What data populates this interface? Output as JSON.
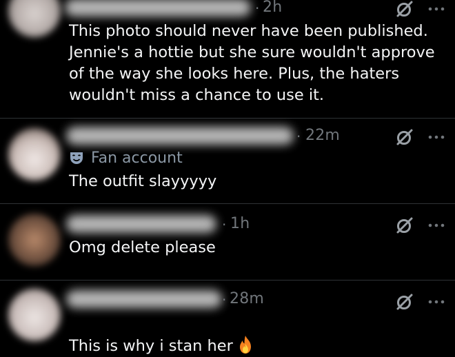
{
  "posts": [
    {
      "time": "2h",
      "text": "This photo should never have been published.\nJennie's a hottie but she sure wouldn't approve\nof the way she looks here. Plus, the haters\nwouldn't miss a chance to use it.",
      "icons": [
        "grok-icon",
        "more-icon"
      ]
    },
    {
      "time": "22m",
      "badge": "Fan account",
      "text": "The outfit slayyyyy",
      "icons": [
        "masks-icon",
        "grok-icon",
        "more-icon"
      ]
    },
    {
      "time": "1h",
      "text": "Omg delete please",
      "icons": [
        "grok-icon",
        "more-icon"
      ]
    },
    {
      "time": "28m",
      "text": "This is why i stan her",
      "icons": [
        "fire-emoji",
        "grok-icon",
        "more-icon"
      ]
    }
  ],
  "colors": {
    "background": "#000000",
    "text": "#e7e9ea",
    "muted": "#71767b",
    "divider": "#2f3336",
    "fan_icon": "#8fa2bb",
    "flame": "#f5821f"
  }
}
